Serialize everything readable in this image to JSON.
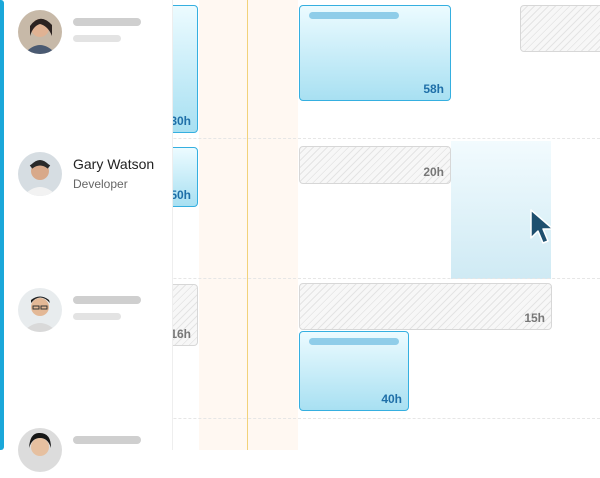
{
  "colors": {
    "accent": "#1aa7d9",
    "assignment_blue": "#35afe0",
    "hours_blue": "#1f6fa8",
    "cursor": "#1f4f6e"
  },
  "people": [
    {
      "name": "",
      "role": "",
      "avatar": "avatar-photo"
    },
    {
      "name": "Gary Watson",
      "role": "Developer",
      "avatar": "avatar-photo"
    },
    {
      "name": "",
      "role": "",
      "avatar": "avatar-photo"
    },
    {
      "name": "",
      "role": "",
      "avatar": "avatar-photo"
    }
  ],
  "assignments": {
    "row1_left": "30h",
    "row1_main": "58h",
    "row2_left": "50h",
    "row2_time_off": "20h",
    "row3_left": "16h",
    "row3_time_off": "15h",
    "row3_main": "40h"
  },
  "cursor_icon": "pointer-arrow-icon"
}
